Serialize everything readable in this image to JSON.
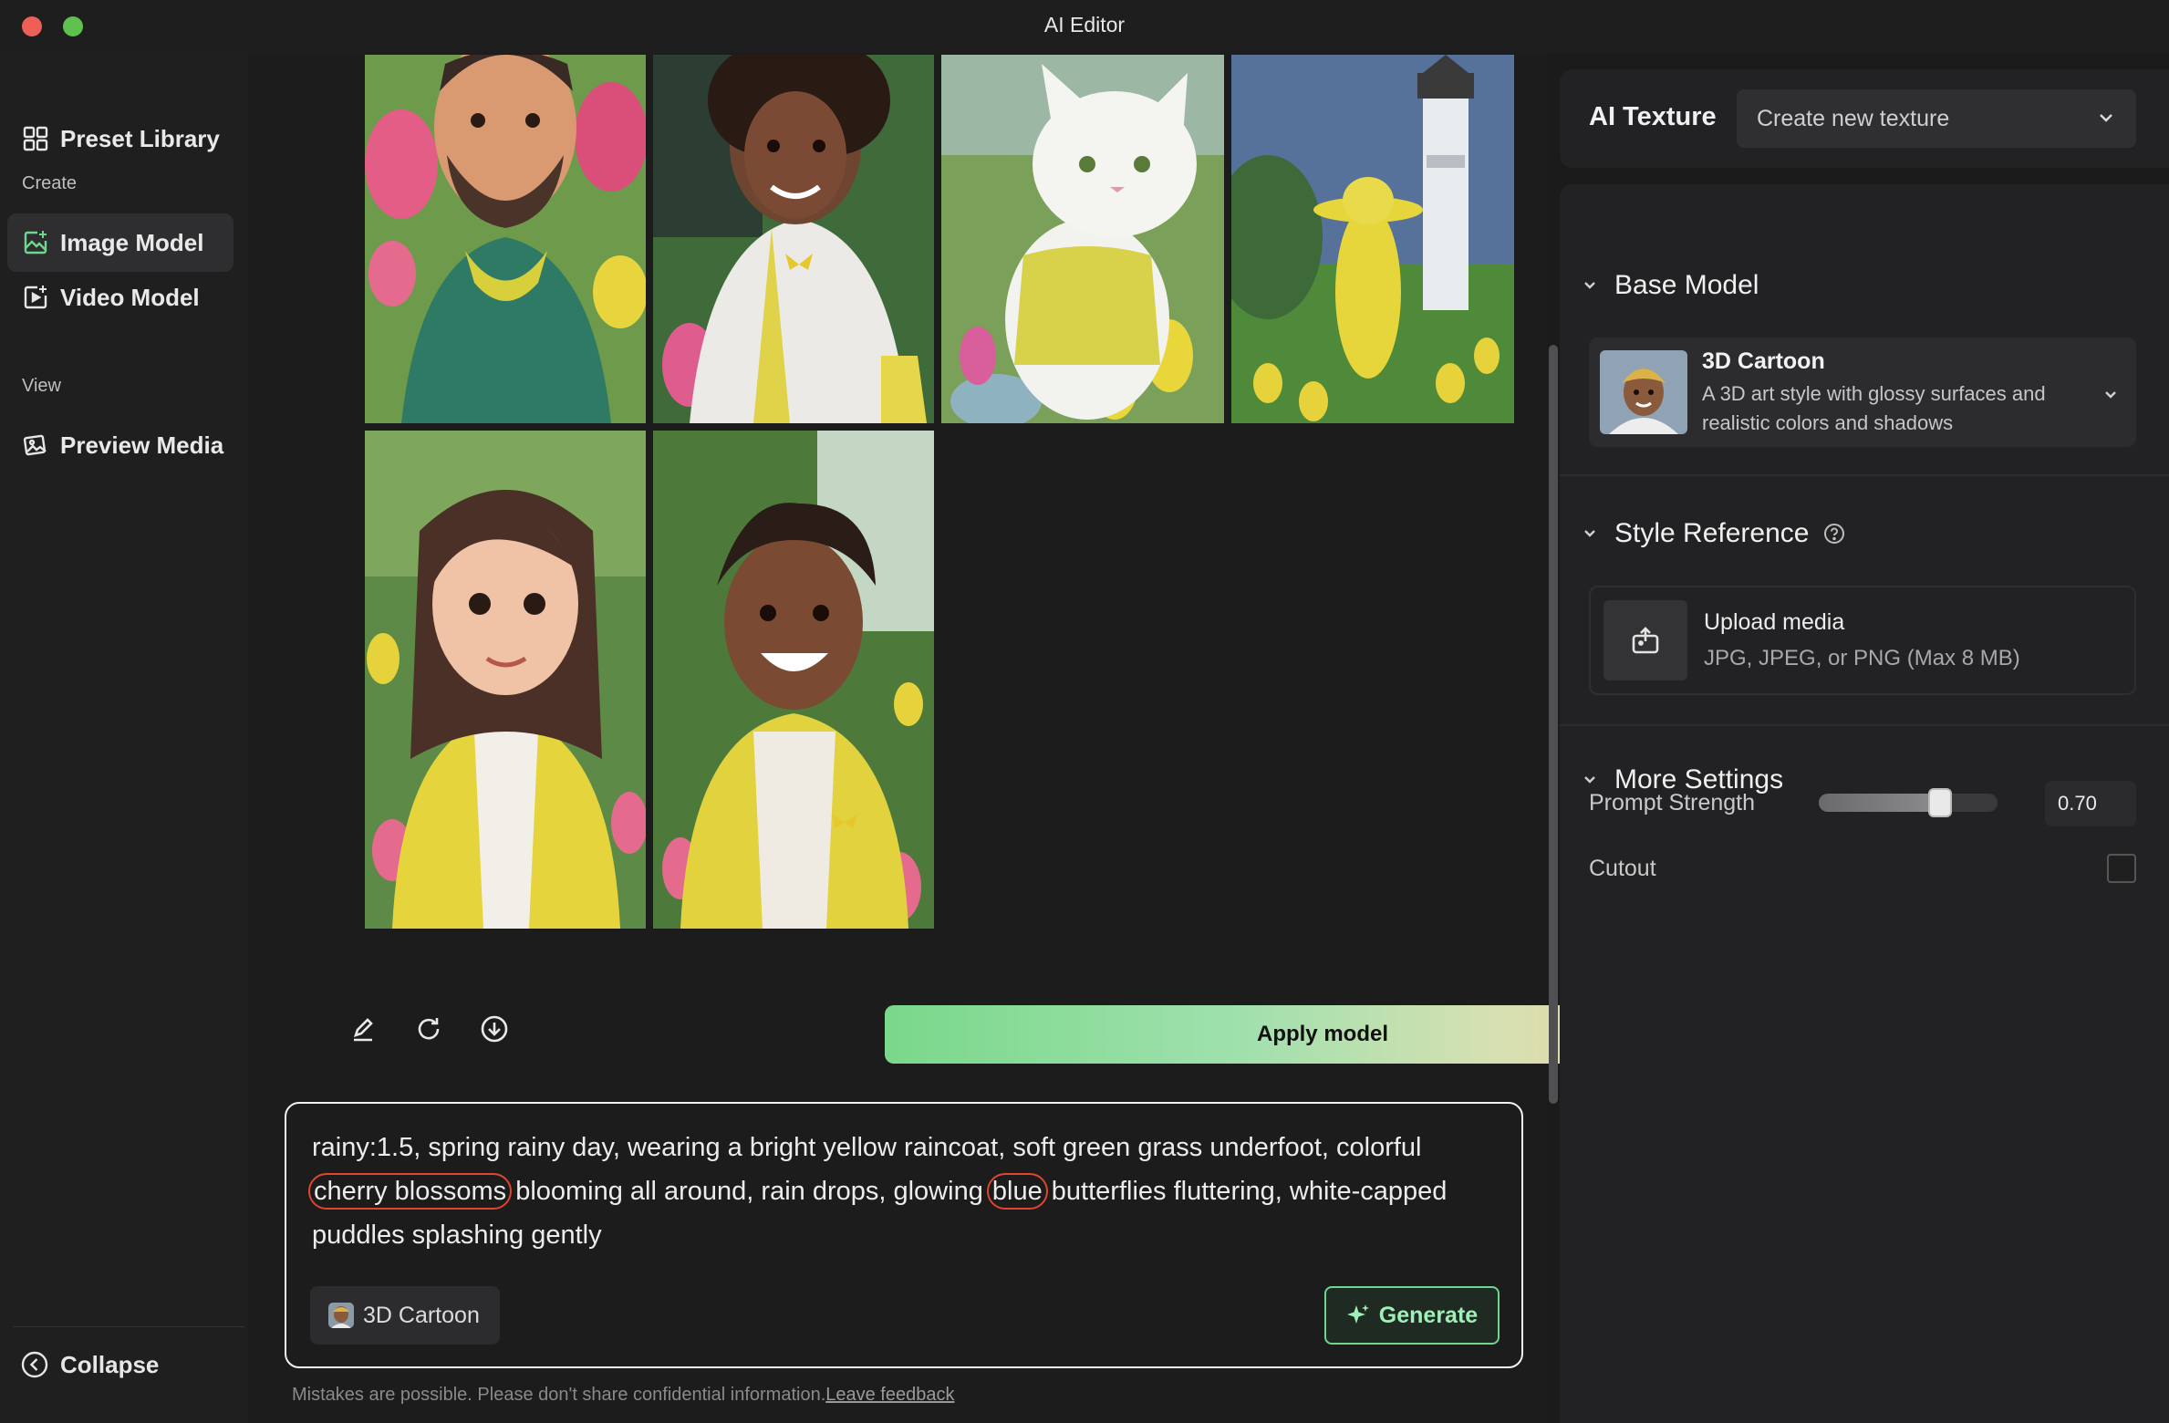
{
  "window": {
    "title": "AI Editor"
  },
  "sidebar": {
    "preset_library": "Preset Library",
    "create_label": "Create",
    "image_model": "Image Model",
    "video_model": "Video Model",
    "view_label": "View",
    "preview_media": "Preview Media",
    "collapse": "Collapse"
  },
  "gallery": {
    "images": [
      {
        "subject": "bearded man in green hoodie"
      },
      {
        "subject": "woman in white jacket with butterfly"
      },
      {
        "subject": "white cat in yellow raincoat"
      },
      {
        "subject": "figure in yellow raincoat near lighthouse"
      },
      {
        "subject": "woman in yellow raincoat"
      },
      {
        "subject": "smiling man in yellow jacket"
      }
    ]
  },
  "toolbar": {
    "apply_label": "Apply model"
  },
  "prompt": {
    "line1": "rainy:1.5, spring rainy day, wearing a bright yellow raincoat, soft green grass underfoot, colorful",
    "hl1": "cherry blossoms",
    "mid": "blooming all around, rain drops, glowing",
    "hl2": "blue",
    "line2_end": "butterflies fluttering, white-capped",
    "line3": "puddles splashing gently",
    "style_chip": "3D Cartoon",
    "generate_label": "Generate"
  },
  "footer": {
    "disclaimer": "Mistakes are possible. Please don't share confidential information.",
    "feedback_link": "Leave feedback"
  },
  "right_panel": {
    "ai_texture_label": "AI Texture",
    "texture_select_value": "Create new texture",
    "base_model_header": "Base Model",
    "model_name": "3D Cartoon",
    "model_desc": "A 3D art style with glossy surfaces and realistic colors and shadows",
    "style_reference_header": "Style Reference",
    "upload_title": "Upload media",
    "upload_sub": "JPG, JPEG, or PNG (Max 8 MB)",
    "more_settings_header": "More Settings",
    "prompt_strength_label": "Prompt Strength",
    "prompt_strength_value": "0.70",
    "cutout_label": "Cutout"
  },
  "colors": {
    "accent_green": "#6fd68e",
    "highlight_red": "#e0452f"
  }
}
